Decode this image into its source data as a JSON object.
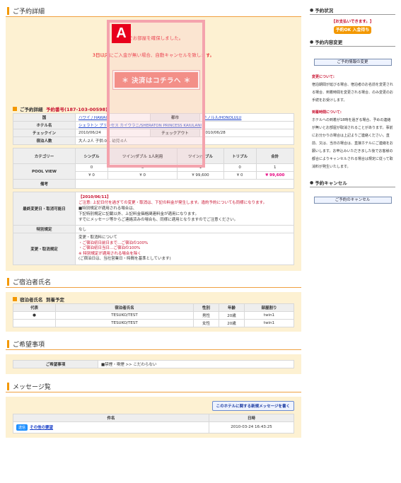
{
  "sections": {
    "details": "ご予約詳細",
    "guest": "ご宿泊者氏名",
    "request": "ご希望事項",
    "message": "メッセージ覧"
  },
  "notice": {
    "line1": "客でお部屋を確保しました。",
    "line2": "3日以内にご入金が無い場合、自動キャンセルを致します。",
    "pay_button": "＊ 決済はコチラへ ＊",
    "marker": "A"
  },
  "detail": {
    "heading": "ご予約詳細",
    "number": "予約番号(187-103-00598)",
    "country_label": "国",
    "country": "ハワイ / HAWAII",
    "city_label": "都市",
    "city": "ホノルル/HONOLULU",
    "hotel_label": "ホテル名",
    "hotel": "シェラトン プリンセス カイウラニ/SHERATON PRINCESS KAIULANI",
    "checkin_label": "チェックイン",
    "checkin": "2010/06/24",
    "checkout_label": "チェックアウト",
    "checkout": "2010/06/28",
    "guests_label": "宿泊人数",
    "guests": "大人:2人 子供:0人 幼児:0人"
  },
  "rooms": {
    "headers": [
      "カテゴリー",
      "シングル",
      "ツイン/ダブル 1人利用",
      "ツイン/ダブル",
      "トリプル",
      "合計"
    ],
    "category": "POOL VIEW",
    "counts": [
      "0",
      "0",
      "1",
      "0",
      "1"
    ],
    "prices": [
      "¥ 0",
      "¥ 0",
      "¥ 99,600",
      "¥ 0",
      "¥ 99,600"
    ]
  },
  "remarks_label": "備考",
  "cancel": {
    "label": "最終変更日・取消可能日",
    "date": "【2010/06/11】",
    "line1": "ご注意: 上記日付を過ぎての変更・取消は、下記の料金が発生します。違約予約についても同様になります。",
    "line2": "■特別規定が適用される場合は、",
    "line3": "下記特別規定に記載以外、上記料金価格関連料金が適用になります。",
    "line4": "すでにメッセージ等からご連絡済みの場合も、同様に適用となりますのでご注意ください。"
  },
  "special": {
    "label": "特別規定",
    "value": "なし"
  },
  "change": {
    "label": "変更・取消規定",
    "lines": [
      "変更・取消料について",
      "・ご宿泊初日前日まで…ご宿泊の100%",
      "・ご宿泊初日当日…ご宿泊の100%",
      "※ 特別規定が適用される場合を除く",
      "(ご宿泊日は、当社営業日・時間を基準としています)"
    ]
  },
  "guest": {
    "heading": "宿泊者氏名",
    "subtitle": "到着予定",
    "headers": [
      "代表",
      "宿泊者氏名",
      "性別",
      "年齢",
      "部屋割り"
    ],
    "rows": [
      [
        "●",
        "TESUKO/TEST",
        "男性",
        "20歳",
        "twin1"
      ],
      [
        "",
        "TESUKO/TEST",
        "女性",
        "20歳",
        "twin1"
      ]
    ]
  },
  "request": {
    "label": "ご希望事項",
    "value": "■禁煙・喫煙 >> こだわらない"
  },
  "message": {
    "button": "このホテルに関する新規メッセージを書く",
    "headers": [
      "件名",
      "日時"
    ],
    "tag": "送信",
    "subject": "その他の要望",
    "date": "2010-03-24 16:43:25"
  },
  "sidebar": {
    "status_title": "予約状況",
    "status_text": "【お支払いできます。】",
    "badge": "予約OK 入金待ち",
    "change_title": "予約内容変更",
    "change_button": "ご予約情報の変更",
    "change_note_title": "変更について:",
    "change_note": "宿泊期間が延びる場合、宿泊者のお名前を変更される場合、到着時間を変更される場合、のみ変更のお手続をお受けします。",
    "name_note_title": "到着時間について:",
    "name_note": "ホテルへの到着が18時を過ぎる場合、予めの連絡が無いとお部屋が取消されることがあります。事前にお分かりの場合は上記よりご連絡ください。直前、又は、当日の場合は、直接ホテルにご連絡をお願いします。お申込みいただきました後でお客様の都合によりキャンセルされる場合は規定に従って取消料が発生いたします。",
    "cancel_title": "予約キャンセル",
    "cancel_button": "ご予約のキャンセル"
  }
}
